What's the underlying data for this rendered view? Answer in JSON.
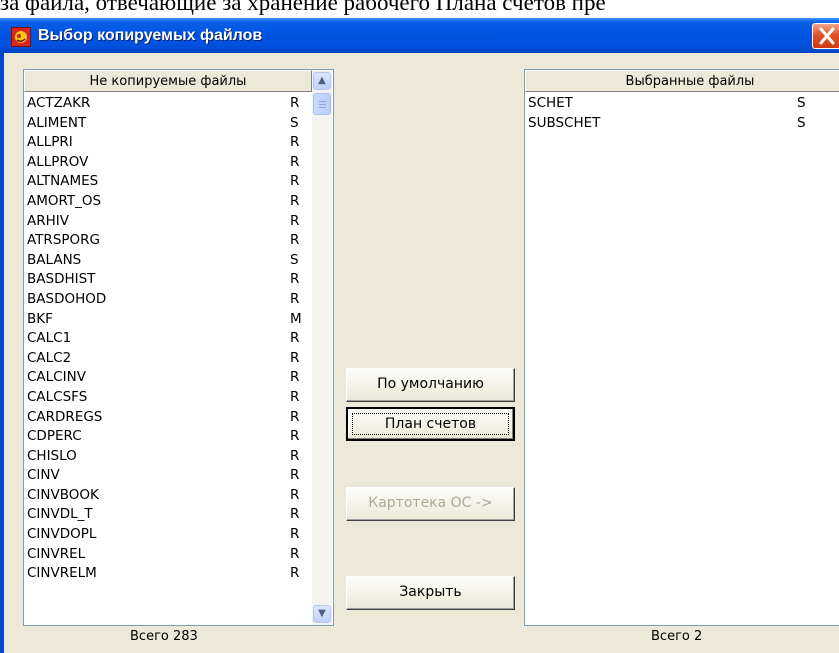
{
  "doc_text": "за файла, отвечающие за хранение рабочего Плана счетов пре",
  "window": {
    "title": "Выбор копируемых файлов"
  },
  "left_list": {
    "header": "Не копируемые файлы",
    "items": [
      {
        "name": "ACTZAKR",
        "flag": "R"
      },
      {
        "name": "ALIMENT",
        "flag": "S"
      },
      {
        "name": "ALLPRI",
        "flag": "R"
      },
      {
        "name": "ALLPROV",
        "flag": "R"
      },
      {
        "name": "ALTNAMES",
        "flag": "R"
      },
      {
        "name": "AMORT_OS",
        "flag": "R"
      },
      {
        "name": "ARHIV",
        "flag": "R"
      },
      {
        "name": "ATRSPORG",
        "flag": "R"
      },
      {
        "name": "BALANS",
        "flag": "S"
      },
      {
        "name": "BASDHIST",
        "flag": "R"
      },
      {
        "name": "BASDOHOD",
        "flag": "R"
      },
      {
        "name": "BKF",
        "flag": "M"
      },
      {
        "name": "CALC1",
        "flag": "R"
      },
      {
        "name": "CALC2",
        "flag": "R"
      },
      {
        "name": "CALCINV",
        "flag": "R"
      },
      {
        "name": "CALCSFS",
        "flag": "R"
      },
      {
        "name": "CARDREGS",
        "flag": "R"
      },
      {
        "name": "CDPERC",
        "flag": "R"
      },
      {
        "name": "CHISLO",
        "flag": "R"
      },
      {
        "name": "CINV",
        "flag": "R"
      },
      {
        "name": "CINVBOOK",
        "flag": "R"
      },
      {
        "name": "CINVDL_T",
        "flag": "R"
      },
      {
        "name": "CINVDOPL",
        "flag": "R"
      },
      {
        "name": "CINVREL",
        "flag": "R"
      },
      {
        "name": "CINVRELM",
        "flag": "R"
      }
    ],
    "total": "Всего 283"
  },
  "right_list": {
    "header": "Выбранные файлы",
    "items": [
      {
        "name": "SCHET",
        "flag": "S"
      },
      {
        "name": "SUBSCHET",
        "flag": "S"
      }
    ],
    "total": "Всего 2"
  },
  "buttons": {
    "default": "По умолчанию",
    "chart_of_accounts": "План счетов",
    "fixed_assets": "Картотека ОС ->",
    "close": "Закрыть"
  },
  "icons": {
    "app": "app-icon",
    "close": "close-icon",
    "scroll_up": "scroll-up-icon",
    "scroll_down": "scroll-down-icon"
  }
}
